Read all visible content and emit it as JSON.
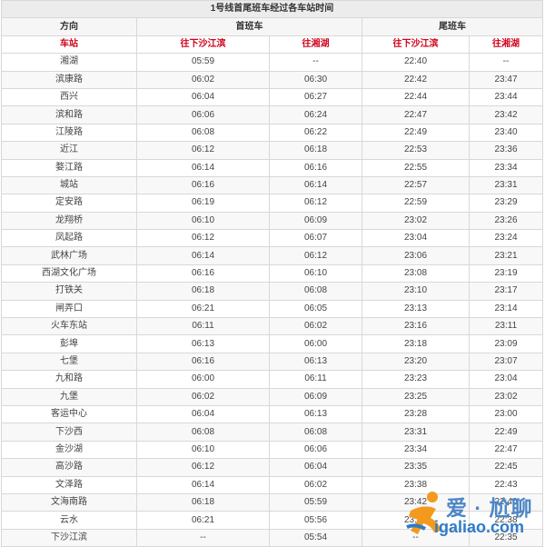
{
  "title": "1号线首尾班车经过各车站时间",
  "header": {
    "direction": "方向",
    "first_train": "首班车",
    "last_train": "尾班车"
  },
  "subheader": {
    "station": "车站",
    "to_xiasha": "往下沙江滨",
    "to_xianghu": "往湘湖"
  },
  "rows": [
    {
      "station": "湘湖",
      "first_to_xiasha": "05:59",
      "first_to_xianghu": "--",
      "last_to_xiasha": "22:40",
      "last_to_xianghu": "--"
    },
    {
      "station": "滨康路",
      "first_to_xiasha": "06:02",
      "first_to_xianghu": "06:30",
      "last_to_xiasha": "22:42",
      "last_to_xianghu": "23:47"
    },
    {
      "station": "西兴",
      "first_to_xiasha": "06:04",
      "first_to_xianghu": "06:27",
      "last_to_xiasha": "22:44",
      "last_to_xianghu": "23:44"
    },
    {
      "station": "滨和路",
      "first_to_xiasha": "06:06",
      "first_to_xianghu": "06:24",
      "last_to_xiasha": "22:47",
      "last_to_xianghu": "23:42"
    },
    {
      "station": "江陵路",
      "first_to_xiasha": "06:08",
      "first_to_xianghu": "06:22",
      "last_to_xiasha": "22:49",
      "last_to_xianghu": "23:40"
    },
    {
      "station": "近江",
      "first_to_xiasha": "06:12",
      "first_to_xianghu": "06:18",
      "last_to_xiasha": "22:53",
      "last_to_xianghu": "23:36"
    },
    {
      "station": "婺江路",
      "first_to_xiasha": "06:14",
      "first_to_xianghu": "06:16",
      "last_to_xiasha": "22:55",
      "last_to_xianghu": "23:34"
    },
    {
      "station": "城站",
      "first_to_xiasha": "06:16",
      "first_to_xianghu": "06:14",
      "last_to_xiasha": "22:57",
      "last_to_xianghu": "23:31"
    },
    {
      "station": "定安路",
      "first_to_xiasha": "06:19",
      "first_to_xianghu": "06:12",
      "last_to_xiasha": "22:59",
      "last_to_xianghu": "23:29"
    },
    {
      "station": "龙翔桥",
      "first_to_xiasha": "06:10",
      "first_to_xianghu": "06:09",
      "last_to_xiasha": "23:02",
      "last_to_xianghu": "23:26"
    },
    {
      "station": "凤起路",
      "first_to_xiasha": "06:12",
      "first_to_xianghu": "06:07",
      "last_to_xiasha": "23:04",
      "last_to_xianghu": "23:24"
    },
    {
      "station": "武林广场",
      "first_to_xiasha": "06:14",
      "first_to_xianghu": "06:12",
      "last_to_xiasha": "23:06",
      "last_to_xianghu": "23:21"
    },
    {
      "station": "西湖文化广场",
      "first_to_xiasha": "06:16",
      "first_to_xianghu": "06:10",
      "last_to_xiasha": "23:08",
      "last_to_xianghu": "23:19"
    },
    {
      "station": "打铁关",
      "first_to_xiasha": "06:18",
      "first_to_xianghu": "06:08",
      "last_to_xiasha": "23:10",
      "last_to_xianghu": "23:17"
    },
    {
      "station": "闸弄口",
      "first_to_xiasha": "06:21",
      "first_to_xianghu": "06:05",
      "last_to_xiasha": "23:13",
      "last_to_xianghu": "23:14"
    },
    {
      "station": "火车东站",
      "first_to_xiasha": "06:11",
      "first_to_xianghu": "06:02",
      "last_to_xiasha": "23:16",
      "last_to_xianghu": "23:11"
    },
    {
      "station": "彭埠",
      "first_to_xiasha": "06:13",
      "first_to_xianghu": "06:00",
      "last_to_xiasha": "23:18",
      "last_to_xianghu": "23:09"
    },
    {
      "station": "七堡",
      "first_to_xiasha": "06:16",
      "first_to_xianghu": "06:13",
      "last_to_xiasha": "23:20",
      "last_to_xianghu": "23:07"
    },
    {
      "station": "九和路",
      "first_to_xiasha": "06:00",
      "first_to_xianghu": "06:11",
      "last_to_xiasha": "23:23",
      "last_to_xianghu": "23:04"
    },
    {
      "station": "九堡",
      "first_to_xiasha": "06:02",
      "first_to_xianghu": "06:09",
      "last_to_xiasha": "23:25",
      "last_to_xianghu": "23:02"
    },
    {
      "station": "客运中心",
      "first_to_xiasha": "06:04",
      "first_to_xianghu": "06:13",
      "last_to_xiasha": "23:28",
      "last_to_xianghu": "23:00"
    },
    {
      "station": "下沙西",
      "first_to_xiasha": "06:08",
      "first_to_xianghu": "06:08",
      "last_to_xiasha": "23:31",
      "last_to_xianghu": "22:49"
    },
    {
      "station": "金沙湖",
      "first_to_xiasha": "06:10",
      "first_to_xianghu": "06:06",
      "last_to_xiasha": "23:34",
      "last_to_xianghu": "22:47"
    },
    {
      "station": "高沙路",
      "first_to_xiasha": "06:12",
      "first_to_xianghu": "06:04",
      "last_to_xiasha": "23:35",
      "last_to_xianghu": "22:45"
    },
    {
      "station": "文泽路",
      "first_to_xiasha": "06:14",
      "first_to_xianghu": "06:02",
      "last_to_xiasha": "23:38",
      "last_to_xianghu": "22:43"
    },
    {
      "station": "文海南路",
      "first_to_xiasha": "06:18",
      "first_to_xianghu": "05:59",
      "last_to_xiasha": "23:42",
      "last_to_xianghu": "22:40"
    },
    {
      "station": "云水",
      "first_to_xiasha": "06:21",
      "first_to_xianghu": "05:56",
      "last_to_xiasha": "23:44",
      "last_to_xianghu": "22:38"
    },
    {
      "station": "下沙江滨",
      "first_to_xiasha": "--",
      "first_to_xianghu": "05:54",
      "last_to_xiasha": "--",
      "last_to_xianghu": "22:35"
    }
  ],
  "watermark": {
    "brand": "爱 · 尬聊",
    "url": "igaliao.com",
    "icon": "person-running-logo-icon",
    "colors": {
      "orange": "#f39a1e",
      "blue": "#2e7bc7"
    }
  }
}
